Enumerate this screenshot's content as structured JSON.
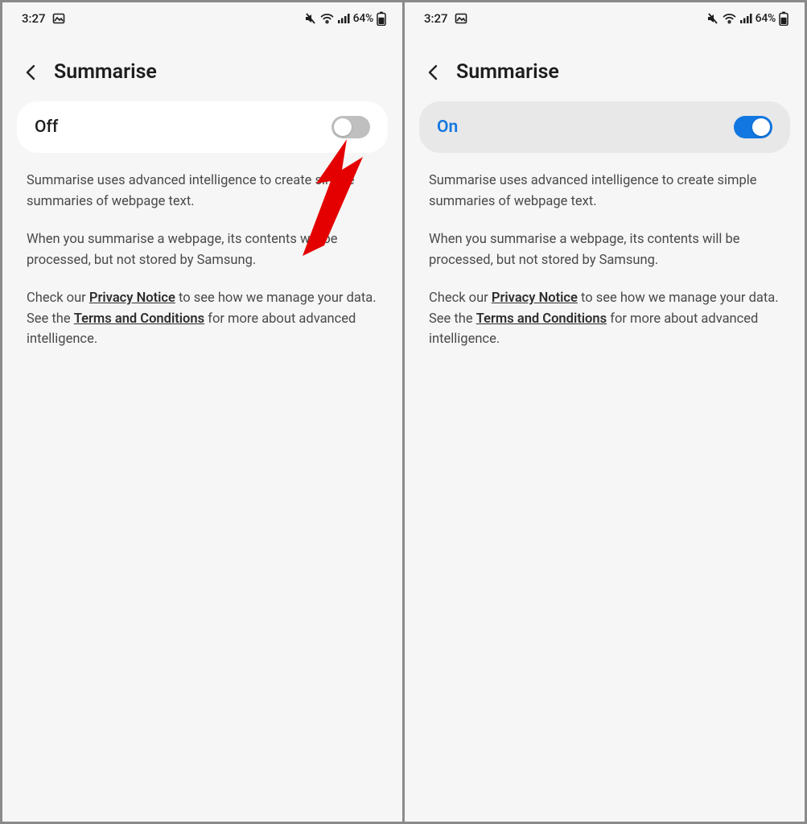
{
  "status": {
    "time": "3:27",
    "battery_text": "64%"
  },
  "header": {
    "title": "Summarise"
  },
  "panels": {
    "left": {
      "state_label": "Off"
    },
    "right": {
      "state_label": "On"
    }
  },
  "description": {
    "p1": "Summarise uses advanced intelligence to create simple summaries of webpage text.",
    "p2": "When you summarise a webpage, its contents will be processed, but not stored by Samsung.",
    "p3_pre": "Check our ",
    "privacy": "Privacy Notice",
    "p3_mid": " to see how we manage your data. See the ",
    "terms": "Terms and Conditions",
    "p3_post": " for more about advanced intelligence."
  }
}
